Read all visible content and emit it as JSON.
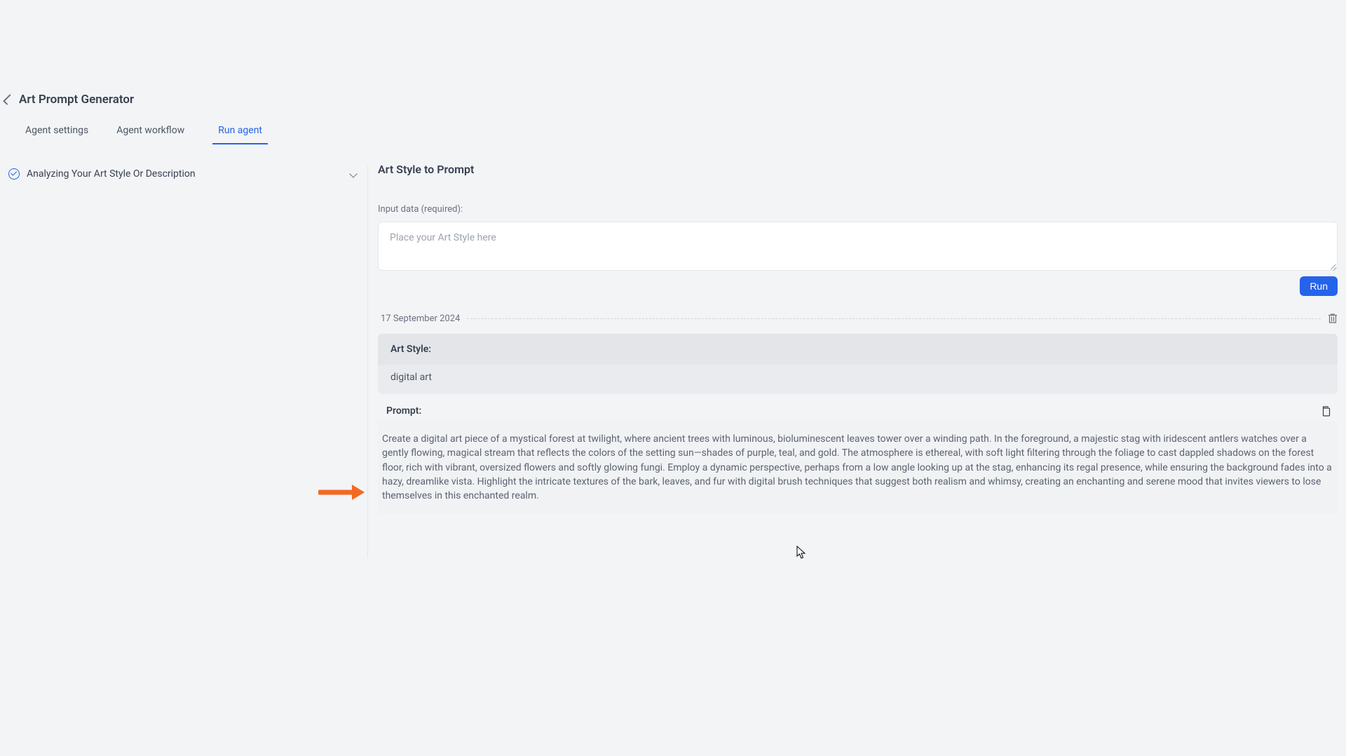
{
  "header": {
    "title": "Art Prompt Generator"
  },
  "tabs": {
    "items": [
      {
        "label": "Agent settings",
        "active": false
      },
      {
        "label": "Agent workflow",
        "active": false
      },
      {
        "label": "Run agent",
        "active": true
      }
    ]
  },
  "sidebar": {
    "step_label": "Analyzing Your Art Style Or Description"
  },
  "main": {
    "section_title": "Art Style to Prompt",
    "input_label": "Input data (required):",
    "input_placeholder": "Place your Art Style here",
    "run_button": "Run",
    "date": "17 September 2024",
    "art_style_label": "Art Style:",
    "art_style_value": "digital art",
    "prompt_label": "Prompt:",
    "prompt_text": "Create a digital art piece of a mystical forest at twilight, where ancient trees with luminous, bioluminescent leaves tower over a winding path. In the foreground, a majestic stag with iridescent antlers watches over a gently flowing, magical stream that reflects the colors of the setting sun—shades of purple, teal, and gold. The atmosphere is ethereal, with soft light filtering through the foliage to cast dappled shadows on the forest floor, rich with vibrant, oversized flowers and softly glowing fungi. Employ a dynamic perspective, perhaps from a low angle looking up at the stag, enhancing its regal presence, while ensuring the background fades into a hazy, dreamlike vista. Highlight the intricate textures of the bark, leaves, and fur with digital brush techniques that suggest both realism and whimsy, creating an enchanting and serene mood that invites viewers to lose themselves in this enchanted realm."
  },
  "colors": {
    "accent": "#2563eb",
    "arrow": "#f26a22"
  }
}
